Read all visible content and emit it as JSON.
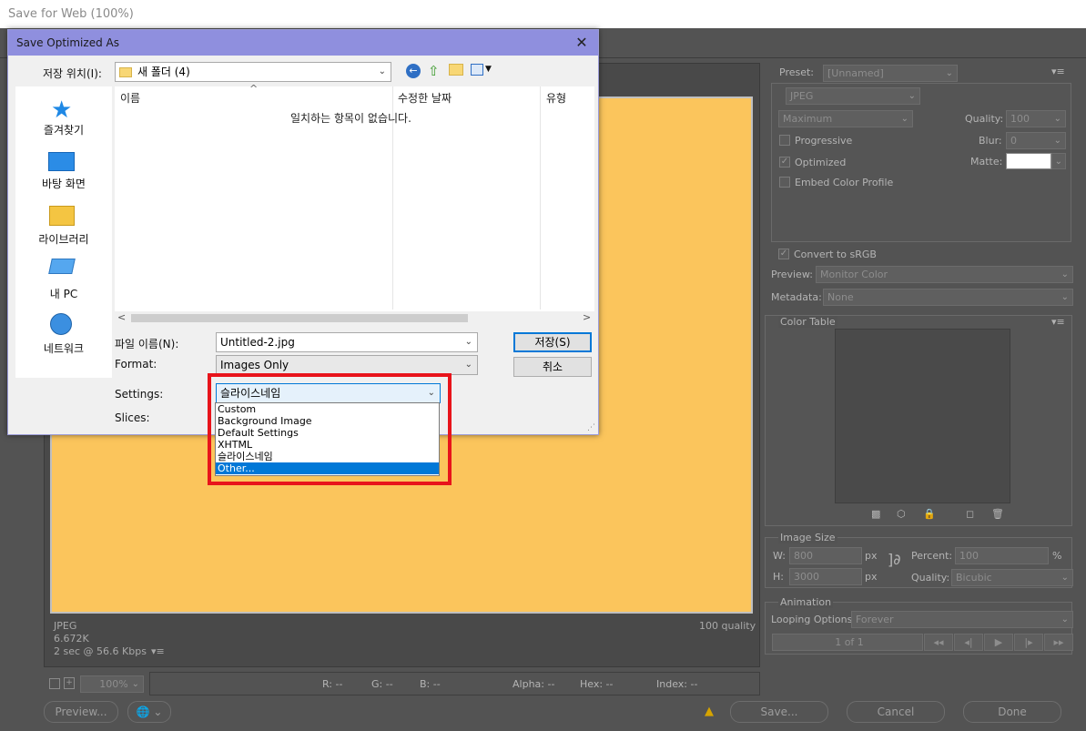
{
  "app": {
    "title": "Save for Web (100%)",
    "canvas": {
      "format": "JPEG",
      "size": "6.672K",
      "timing": "2 sec @ 56.6 Kbps",
      "timing_menu": "▾≡",
      "quality_note": "100 quality"
    },
    "statusbar": {
      "zoom": "100%",
      "r": "R: --",
      "g": "G: --",
      "b": "B: --",
      "alpha": "Alpha: --",
      "hex": "Hex: --",
      "index": "Index: --"
    },
    "bottom": {
      "preview_button": "Preview...",
      "save_button": "Save...",
      "cancel_button": "Cancel",
      "done_button": "Done"
    },
    "panel": {
      "preset_label": "Preset:",
      "preset_value": "[Unnamed]",
      "format_value": "JPEG",
      "quality_level": "Maximum",
      "quality_label": "Quality:",
      "quality_value": "100",
      "progressive_label": "Progressive",
      "blur_label": "Blur:",
      "blur_value": "0",
      "optimized_label": "Optimized",
      "matte_label": "Matte:",
      "embed_label": "Embed Color Profile",
      "convert_label": "Convert to sRGB",
      "preview_label": "Preview:",
      "preview_value": "Monitor Color",
      "metadata_label": "Metadata:",
      "metadata_value": "None",
      "color_table_label": "Color Table",
      "image_size_label": "Image Size",
      "w_label": "W:",
      "w_value": "800",
      "h_label": "H:",
      "h_value": "3000",
      "px": "px",
      "percent_label": "Percent:",
      "percent_value": "100",
      "percent_sign": "%",
      "quality2_label": "Quality:",
      "quality2_value": "Bicubic",
      "animation_label": "Animation",
      "looping_label": "Looping Options:",
      "looping_value": "Forever",
      "frame_counter": "1 of 1"
    }
  },
  "dialog": {
    "title": "Save Optimized As",
    "save_in_label": "저장 위치(I):",
    "save_in_value": "새 폴더 (4)",
    "places": [
      "즐겨찾기",
      "바탕 화면",
      "라이브러리",
      "내 PC",
      "네트워크"
    ],
    "columns": [
      "이름",
      "수정한 날짜",
      "유형"
    ],
    "empty_message": "일치하는 항목이 없습니다.",
    "filename_label": "파일 이름(N):",
    "filename_value": "Untitled-2.jpg",
    "format_label": "Format:",
    "format_value": "Images Only",
    "settings_label": "Settings:",
    "settings_value": "슬라이스네임",
    "slices_label": "Slices:",
    "save_button": "저장(S)",
    "cancel_button": "취소",
    "settings_options": [
      "Custom",
      "Background Image",
      "Default Settings",
      "XHTML",
      "슬라이스네임",
      "Other..."
    ],
    "selected_option_index": 5
  },
  "colors": {
    "canvas_fill": "#fbc55c",
    "dialog_title_bar": "#8f8fde",
    "highlight": "#0078d7",
    "annotation_red": "#e8141b"
  }
}
